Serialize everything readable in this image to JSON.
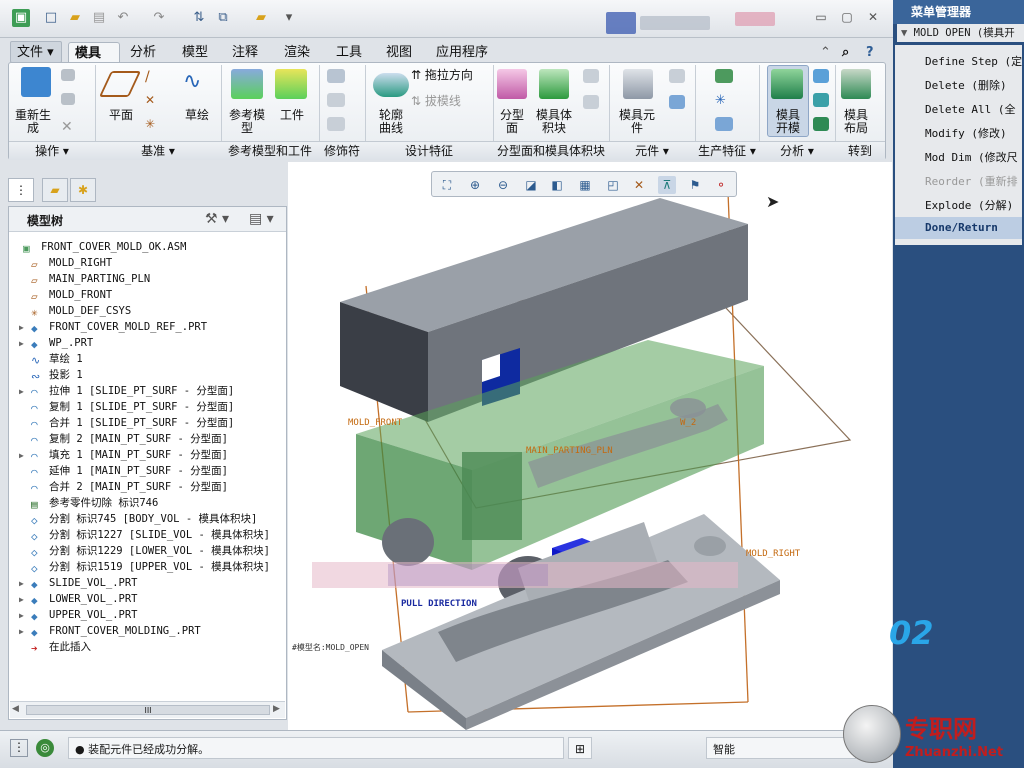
{
  "quick_access": {
    "icons": [
      "app-icon",
      "new-icon",
      "open-icon",
      "save-icon",
      "undo-icon",
      "redo-icon",
      "regenerate-icon",
      "windows-icon",
      "folder-icon",
      "customize-icon"
    ]
  },
  "window": {
    "title_blurred": "",
    "controls": [
      "minimize",
      "maximize",
      "close"
    ]
  },
  "tabs": [
    {
      "label": "文件"
    },
    {
      "label": "模具"
    },
    {
      "label": "分析"
    },
    {
      "label": "模型"
    },
    {
      "label": "注释"
    },
    {
      "label": "渲染"
    },
    {
      "label": "工具"
    },
    {
      "label": "视图"
    },
    {
      "label": "应用程序"
    }
  ],
  "ribbon": {
    "buttons": {
      "regen": "重新生\n成",
      "plane": "平面",
      "sketch": "草绘",
      "refmodel": "参考模\n型",
      "workpiece": "工件",
      "contour": "轮廓\n曲线",
      "drag_dir": "拖拉方向",
      "draft": "拔模线",
      "parting_surface": "分型\n面",
      "mold_volume": "模具体\n积块",
      "mold_component": "模具元\n件",
      "mold_open": "模具\n开模",
      "mold_layout": "模具\n布局"
    },
    "groups": [
      "操作",
      "基准",
      "参考模型和工件",
      "修饰符",
      "设计特征",
      "分型面和模具体积块",
      "元件",
      "生产特征",
      "分析",
      "转到"
    ]
  },
  "tree": {
    "title": "模型树",
    "rows": [
      {
        "text": "FRONT_COVER_MOLD_OK.ASM",
        "indent": 0,
        "expand": false,
        "icon": "assembly-icon"
      },
      {
        "text": "MOLD_RIGHT",
        "indent": 1,
        "expand": false,
        "icon": "datum-plane-icon"
      },
      {
        "text": "MAIN_PARTING_PLN",
        "indent": 1,
        "expand": false,
        "icon": "datum-plane-icon"
      },
      {
        "text": "MOLD_FRONT",
        "indent": 1,
        "expand": false,
        "icon": "datum-plane-icon"
      },
      {
        "text": "MOLD_DEF_CSYS",
        "indent": 1,
        "expand": false,
        "icon": "csys-icon"
      },
      {
        "text": "FRONT_COVER_MOLD_REF_.PRT",
        "indent": 1,
        "expand": true,
        "icon": "part-icon"
      },
      {
        "text": "WP_.PRT",
        "indent": 1,
        "expand": true,
        "icon": "part-icon"
      },
      {
        "text": "草绘 1",
        "indent": 1,
        "expand": false,
        "icon": "sketch-icon"
      },
      {
        "text": "投影 1",
        "indent": 1,
        "expand": false,
        "icon": "project-icon"
      },
      {
        "text": "拉伸 1 [SLIDE_PT_SURF - 分型面]",
        "indent": 1,
        "expand": true,
        "icon": "surface-icon"
      },
      {
        "text": "复制 1 [SLIDE_PT_SURF - 分型面]",
        "indent": 1,
        "expand": false,
        "icon": "surface-icon"
      },
      {
        "text": "合并 1 [SLIDE_PT_SURF - 分型面]",
        "indent": 1,
        "expand": false,
        "icon": "surface-icon"
      },
      {
        "text": "复制 2 [MAIN_PT_SURF - 分型面]",
        "indent": 1,
        "expand": false,
        "icon": "surface-icon"
      },
      {
        "text": "填充 1 [MAIN_PT_SURF - 分型面]",
        "indent": 1,
        "expand": true,
        "icon": "surface-icon"
      },
      {
        "text": "延伸 1 [MAIN_PT_SURF - 分型面]",
        "indent": 1,
        "expand": false,
        "icon": "surface-icon"
      },
      {
        "text": "合并 2 [MAIN_PT_SURF - 分型面]",
        "indent": 1,
        "expand": false,
        "icon": "surface-icon"
      },
      {
        "text": "参考零件切除 标识746",
        "indent": 1,
        "expand": false,
        "icon": "cut-icon"
      },
      {
        "text": "分割 标识745 [BODY_VOL - 模具体积块]",
        "indent": 1,
        "expand": false,
        "icon": "split-icon"
      },
      {
        "text": "分割 标识1227 [SLIDE_VOL - 模具体积块]",
        "indent": 1,
        "expand": false,
        "icon": "split-icon"
      },
      {
        "text": "分割 标识1229 [LOWER_VOL - 模具体积块]",
        "indent": 1,
        "expand": false,
        "icon": "split-icon"
      },
      {
        "text": "分割 标识1519 [UPPER_VOL - 模具体积块]",
        "indent": 1,
        "expand": false,
        "icon": "split-icon"
      },
      {
        "text": "SLIDE_VOL_.PRT",
        "indent": 1,
        "expand": true,
        "icon": "part-icon"
      },
      {
        "text": "LOWER_VOL_.PRT",
        "indent": 1,
        "expand": true,
        "icon": "part-icon"
      },
      {
        "text": "UPPER_VOL_.PRT",
        "indent": 1,
        "expand": true,
        "icon": "part-icon"
      },
      {
        "text": "FRONT_COVER_MOLDING_.PRT",
        "indent": 1,
        "expand": true,
        "icon": "part-icon"
      },
      {
        "text": "在此插入",
        "indent": 1,
        "expand": false,
        "icon": "insert-arrow-icon"
      }
    ],
    "scroll_label": "III"
  },
  "viewport": {
    "labels": {
      "mold_front": "MOLD_FRONT",
      "main_parting": "MAIN_PARTING_PLN",
      "mold_right": "MOLD_RIGHT",
      "pull_direction": "PULL DIRECTION",
      "mold_open": "#模型名:MOLD_OPEN",
      "w2": "W_2"
    }
  },
  "status": {
    "message": "● 装配元件已经成功分解。",
    "filter": "智能"
  },
  "menu_manager": {
    "title": "菜单管理器",
    "header": "MOLD OPEN (模具开",
    "items": [
      {
        "label": "Define Step (定",
        "enabled": true
      },
      {
        "label": "Delete (删除)",
        "enabled": true
      },
      {
        "label": "Delete All (全",
        "enabled": true
      },
      {
        "label": "Modify (修改)",
        "enabled": true
      },
      {
        "label": "Mod Dim (修改尺",
        "enabled": true
      },
      {
        "label": "Reorder (重新排",
        "enabled": false
      },
      {
        "label": "Explode (分解)",
        "enabled": true
      },
      {
        "label": "Done/Return",
        "enabled": true
      }
    ]
  },
  "decor": {
    "version_text": "02",
    "watermark_cn": "专职网",
    "watermark_url": "Zhuanzhi.Net"
  }
}
